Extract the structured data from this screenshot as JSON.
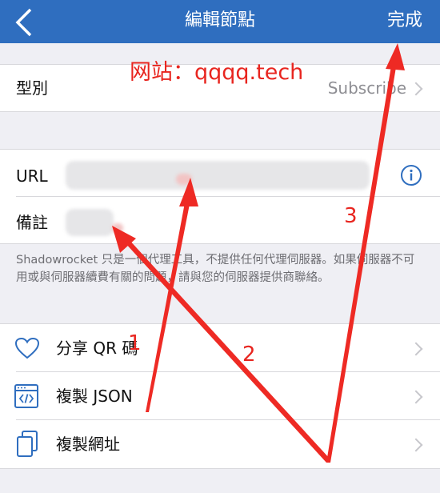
{
  "nav": {
    "title": "編輯節點",
    "done": "完成"
  },
  "type_row": {
    "label": "型別",
    "value": "Subscribe"
  },
  "url_row": {
    "label": "URL"
  },
  "note_row": {
    "label": "備註"
  },
  "footer_note": "Shadowrocket 只是一個代理工具，不提供任何代理伺服器。如果伺服器不可用或與伺服器續費有關的問題，請與您的伺服器提供商聯絡。",
  "actions": [
    {
      "label": "分享 QR 碼",
      "icon": "heart-icon"
    },
    {
      "label": "複製 JSON",
      "icon": "code-window-icon"
    },
    {
      "label": "複製網址",
      "icon": "copy-icon"
    }
  ],
  "annotations": {
    "watermark": "网站：qqqq.tech",
    "step1": "1",
    "step2": "2",
    "step3": "3"
  },
  "colors": {
    "nav": "#2f6ebf",
    "accent": "#2f6ebf",
    "annotation": "#e8251f"
  }
}
